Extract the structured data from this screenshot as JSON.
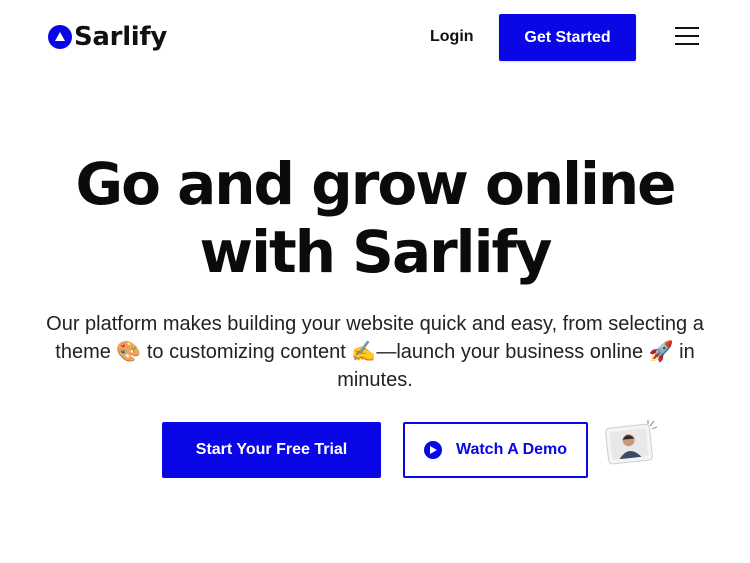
{
  "brand": {
    "name": "Sarlify",
    "accent_color": "#0a07e6"
  },
  "nav": {
    "login_label": "Login",
    "get_started_label": "Get Started",
    "menu_icon": "hamburger-menu-icon"
  },
  "hero": {
    "title_line1": "Go and grow online",
    "title_line2": "with Sarlify",
    "subtitle": "Our platform makes building your website quick and easy, from selecting a theme 🎨 to customizing content ✍️—launch your business online 🚀 in minutes."
  },
  "cta": {
    "primary_label": "Start Your Free Trial",
    "secondary_label": "Watch A Demo",
    "play_icon": "play-icon",
    "avatar_icon": "video-thumbnail-avatar"
  }
}
